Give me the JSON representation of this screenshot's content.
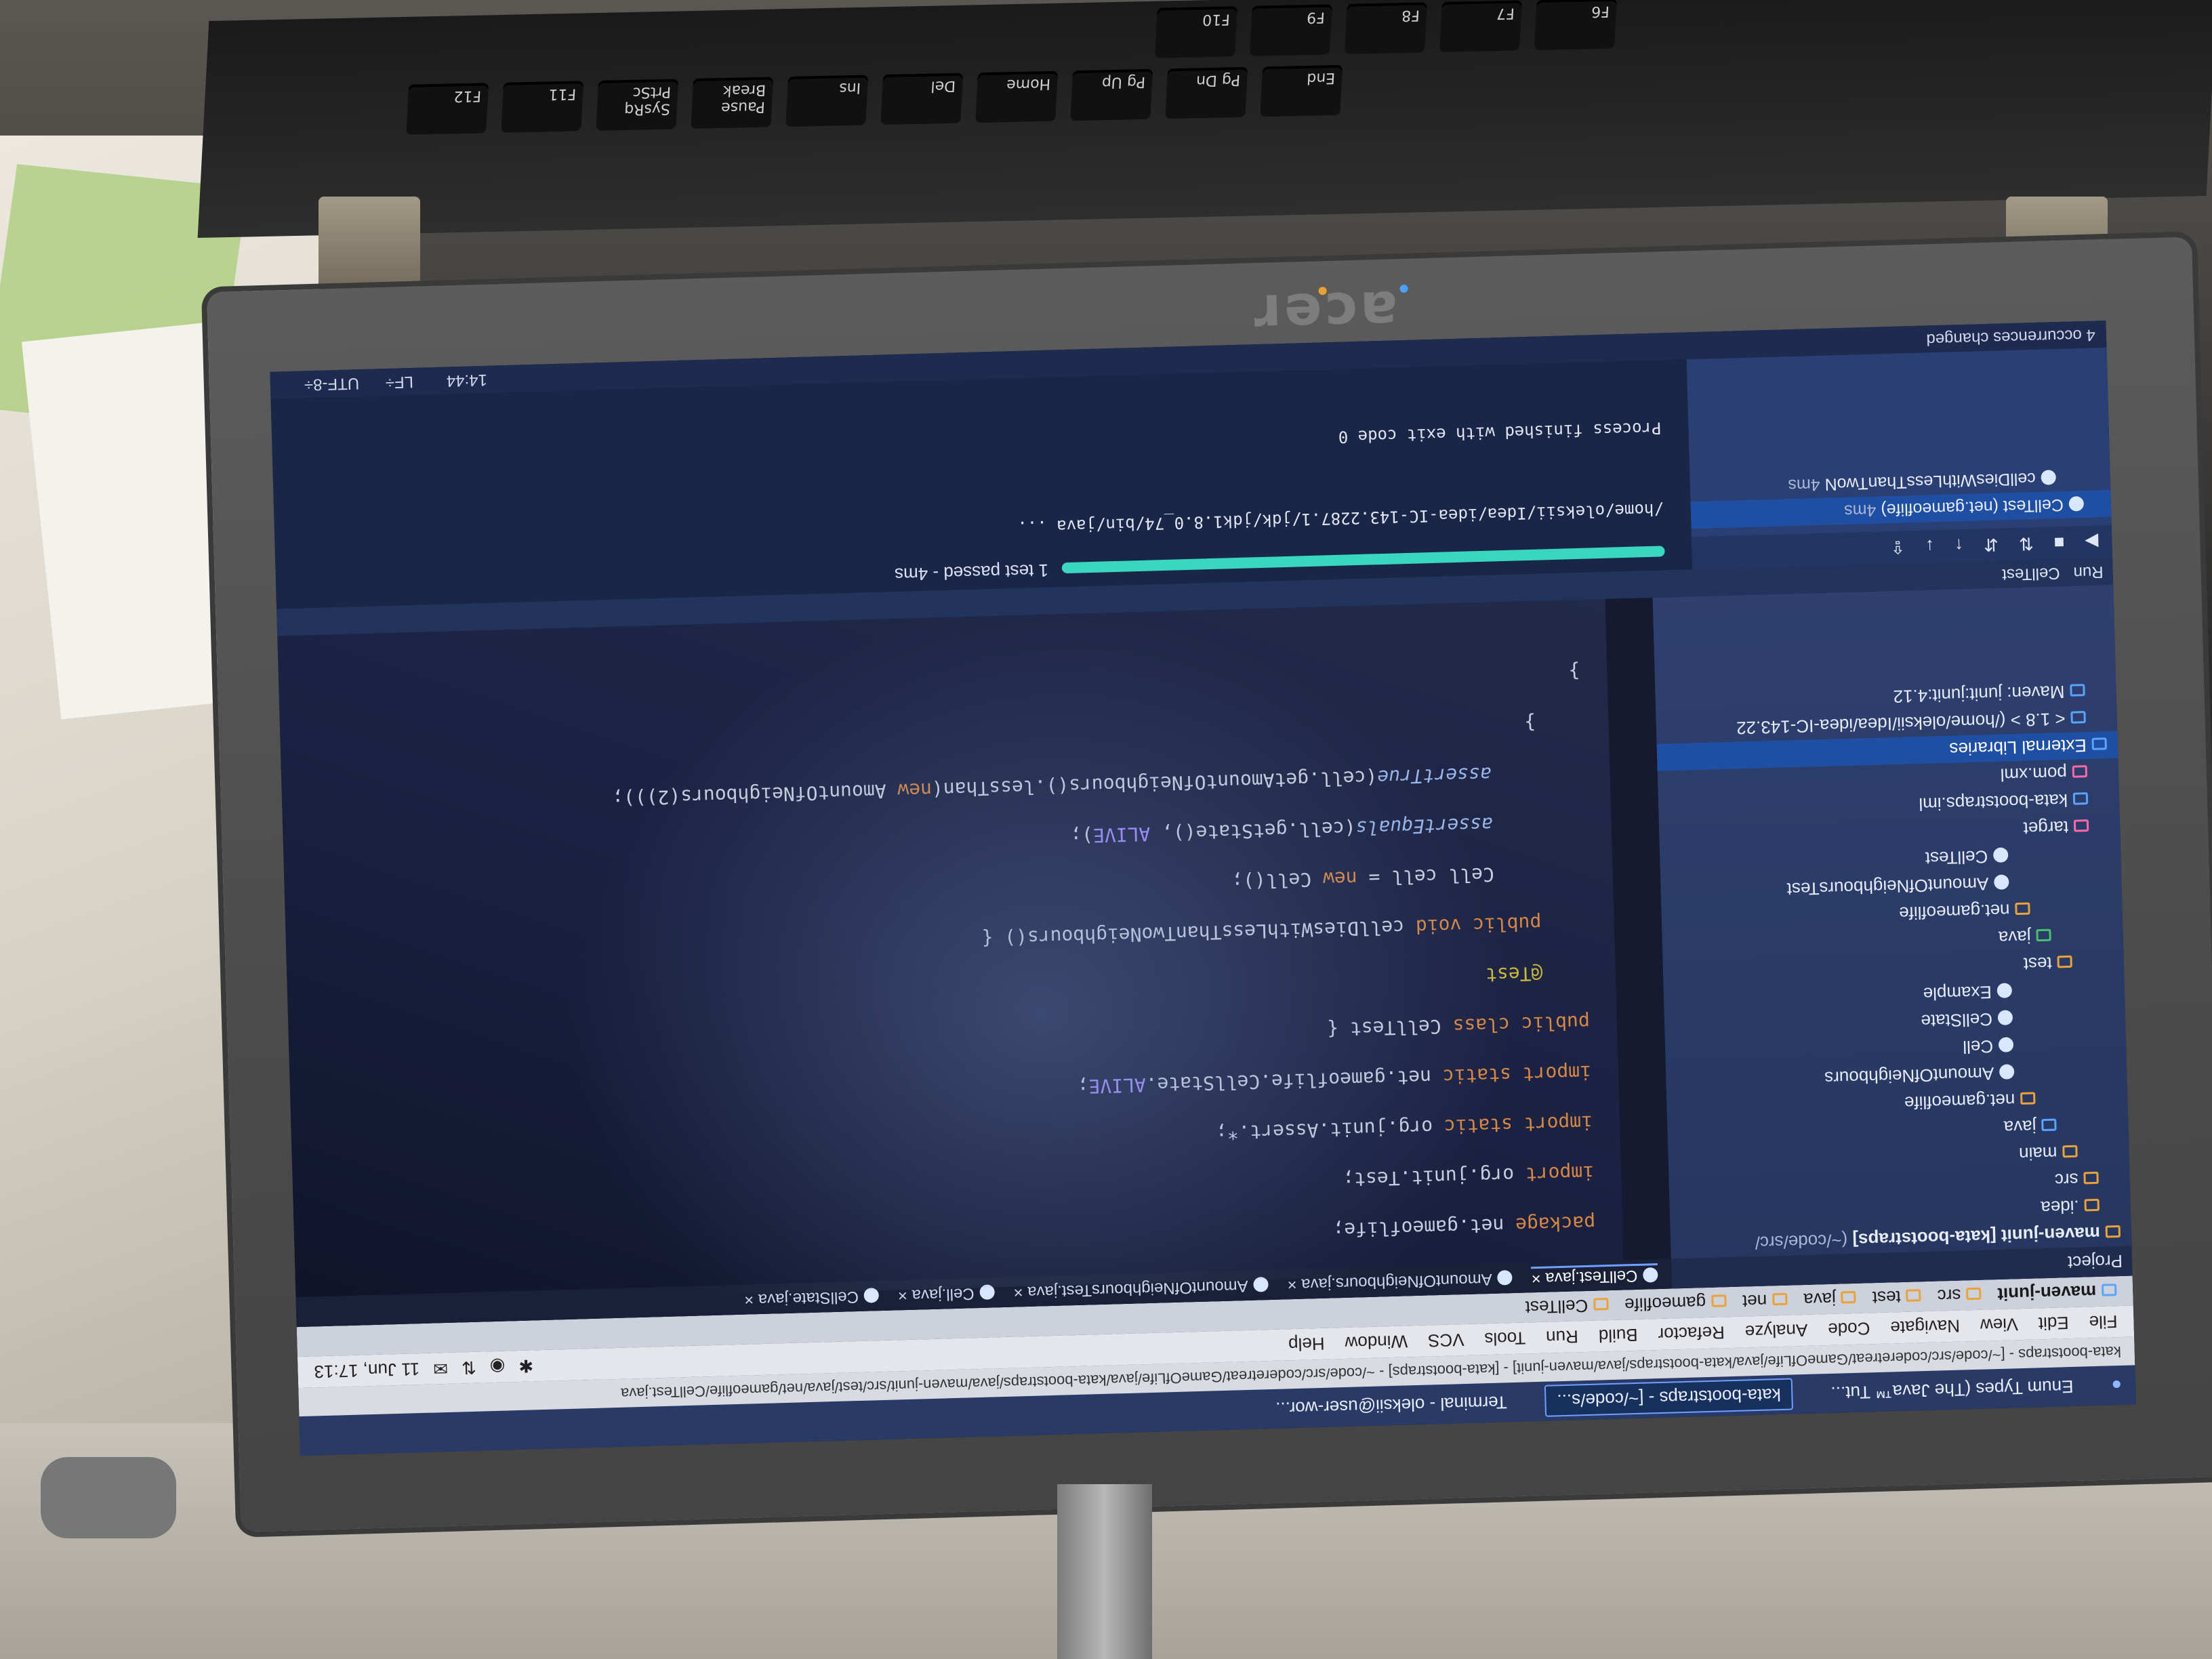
{
  "photo": {
    "laptop_brand": "acer"
  },
  "keyboard": {
    "keys_row1": [
      "F10",
      "F9",
      "F8",
      "F7",
      "F6"
    ],
    "keys_row2": [
      "F12",
      "F11",
      "SysRq PrtSc",
      "Pause Break",
      "Ins",
      "Del",
      "Home",
      "Pg Up",
      "Pg Dn",
      "End"
    ]
  },
  "taskbar": {
    "tasks": [
      "Enum Types (The Java™ Tut...",
      "kata-bootstraps - [~/code/s...",
      "Terminal - oleksii@user-wor..."
    ],
    "active_index": 1
  },
  "titlebar": {
    "text": "kata-bootstraps - [~/code/src/coderetreat/GameOfLife/java/kata-bootstraps/java/maven-junit] - [kata-bootstraps] - ~/code/src/coderetreat/GameOfLife/java/kata-bootstraps/java/maven-junit/src/test/java/net/gameoflife/CellTest.java"
  },
  "menubar": {
    "items": [
      "File",
      "Edit",
      "View",
      "Navigate",
      "Code",
      "Analyze",
      "Refactor",
      "Build",
      "Run",
      "Tools",
      "VCS",
      "Window",
      "Help"
    ],
    "clock": "11 Jun, 17:13"
  },
  "navbar": {
    "crumbs": [
      "maven-junit",
      "src",
      "test",
      "java",
      "net",
      "gameoflife",
      "CellTest"
    ]
  },
  "project": {
    "header": "Project",
    "rows": [
      {
        "label": "maven-junit [kata-bootstraps]",
        "extra": "(~/code/src/",
        "icon": "folder",
        "level": 0
      },
      {
        "label": ".idea",
        "icon": "folder",
        "level": 1
      },
      {
        "label": "src",
        "icon": "folder",
        "level": 1
      },
      {
        "label": "main",
        "icon": "folder",
        "level": 2
      },
      {
        "label": "java",
        "icon": "folder-blue",
        "level": 3
      },
      {
        "label": "net.gameoflife",
        "icon": "package",
        "level": 4
      },
      {
        "label": "AmountOfNeighbours",
        "icon": "class",
        "level": 5
      },
      {
        "label": "Cell",
        "icon": "class",
        "level": 5
      },
      {
        "label": "CellState",
        "icon": "class",
        "level": 5
      },
      {
        "label": "Example",
        "icon": "class",
        "level": 5
      },
      {
        "label": "test",
        "icon": "folder",
        "level": 2
      },
      {
        "label": "java",
        "icon": "folder-green",
        "level": 3
      },
      {
        "label": "net.gameoflife",
        "icon": "package",
        "level": 4
      },
      {
        "label": "AmountOfNeighboursTest",
        "icon": "class",
        "level": 5
      },
      {
        "label": "CellTest",
        "icon": "class",
        "level": 5
      },
      {
        "label": "target",
        "icon": "folder-pink",
        "level": 1
      },
      {
        "label": "kata-bootstraps.iml",
        "icon": "file",
        "level": 1
      },
      {
        "label": "pom.xml",
        "icon": "maven",
        "level": 1
      },
      {
        "label": "External Libraries",
        "icon": "lib",
        "level": 0,
        "selected": true
      },
      {
        "label": "< 1.8 > (/home/oleksii/Idea/idea-IC-143.22",
        "icon": "lib",
        "level": 1
      },
      {
        "label": "Maven: junit:junit:4.12",
        "icon": "lib",
        "level": 1
      }
    ]
  },
  "editor": {
    "tabs": [
      "CellTest.java",
      "AmountOfNeighbours.java",
      "AmountOfNeighboursTest.java",
      "Cell.java",
      "CellState.java"
    ],
    "active_tab": 0,
    "run_config": "CellTest",
    "code": [
      "package net.gameoflife;",
      "import org.junit.Test;",
      "import static org.junit.Assert.*;",
      "import static net.gameoflife.CellState.ALIVE;",
      "public class CellTest {",
      "    @Test",
      "    public void cellDiesWithLessThanTwoNeighbours() {",
      "        Cell cell = new Cell();",
      "        assertEquals(cell.getState(), ALIVE);",
      "        assertTrue(cell.getAmountOfNeighbours().lessThan(new AmountOfNeighbours(2)));",
      "    }",
      "}"
    ]
  },
  "run": {
    "header": "Run",
    "config": "CellTest",
    "tree": [
      {
        "label": "CellTest (net.gameoflife)",
        "time": "4ms"
      },
      {
        "label": "cellDiesWithLessThanTwoN",
        "time": "4ms"
      }
    ],
    "progress": 1.0,
    "passed_text": "1 test passed",
    "passed_time": " - 4ms",
    "console": [
      "/home/oleksii/Idea/idea-IC-143.2287.1/jdk/jdk1.8.0_74/bin/java ...",
      "",
      "Process finished with exit code 0"
    ]
  },
  "statusbar": {
    "message": "4 occurrences changed",
    "position": "14:44",
    "line_sep": "LF÷",
    "encoding": "UTF-8÷"
  }
}
